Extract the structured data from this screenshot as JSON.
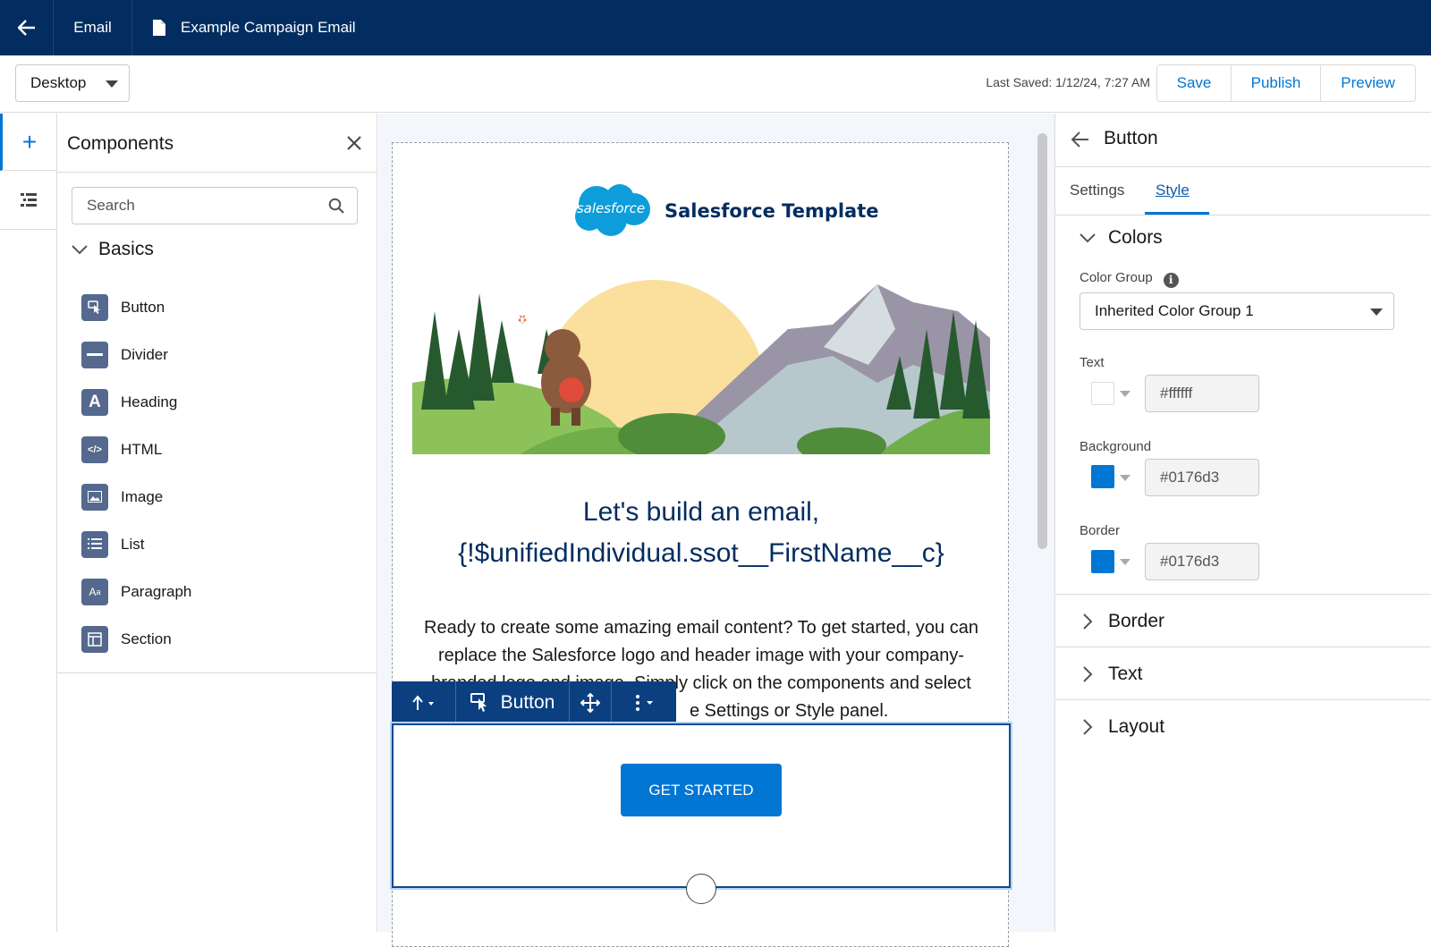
{
  "topbar": {
    "back_icon": "arrow-left-icon",
    "tab_email": "Email",
    "doc_icon": "document-icon",
    "tab_campaign": "Example Campaign Email"
  },
  "toolbar": {
    "device": "Desktop",
    "last_saved": "Last Saved: 1/12/24, 7:27 AM",
    "save": "Save",
    "publish": "Publish",
    "preview": "Preview"
  },
  "rail": {
    "add_label": "+",
    "add_icon": "plus-icon",
    "outline_icon": "list-icon"
  },
  "components": {
    "title": "Components",
    "search_placeholder": "Search",
    "group": "Basics",
    "items": [
      {
        "label": "Button",
        "icon": "cursor-hand-icon"
      },
      {
        "label": "Divider",
        "icon": "divider-icon"
      },
      {
        "label": "Heading",
        "icon": "heading-icon"
      },
      {
        "label": "HTML",
        "icon": "code-icon"
      },
      {
        "label": "Image",
        "icon": "image-icon"
      },
      {
        "label": "List",
        "icon": "list-icon"
      },
      {
        "label": "Paragraph",
        "icon": "paragraph-icon"
      },
      {
        "label": "Section",
        "icon": "section-icon"
      }
    ]
  },
  "email": {
    "logo_text": "salesforce",
    "brand_title": "Salesforce Template",
    "headline_line1": "Let's build an email,",
    "headline_line2": "{!$unifiedIndividual.ssot__FirstName__c}",
    "body_line1": "Ready to create some amazing email content? To get started, you can",
    "body_line2": "replace the Salesforce logo and header image with your company-",
    "body_line3": "branded logo and image. Simply click on the components and select",
    "body_line4": "e Settings or Style panel.",
    "cta": "GET STARTED"
  },
  "context_toolbar": {
    "label": "Button",
    "select_parent_icon": "arrow-up-icon",
    "button_icon": "cursor-hand-icon",
    "move_icon": "move-icon",
    "more_icon": "more-vertical-icon"
  },
  "props": {
    "title": "Button",
    "tab_settings": "Settings",
    "tab_style": "Style",
    "colors_title": "Colors",
    "color_group_label": "Color Group",
    "color_group_value": "Inherited Color Group 1",
    "text_label": "Text",
    "text_hex": "#ffffff",
    "bg_label": "Background",
    "bg_hex": "#0176d3",
    "border_label": "Border",
    "border_hex": "#0176d3",
    "section_border": "Border",
    "section_text": "Text",
    "section_layout": "Layout"
  },
  "colors": {
    "brand_navy": "#032d60",
    "accent": "#0176d3",
    "icon_slate": "#54698d"
  }
}
